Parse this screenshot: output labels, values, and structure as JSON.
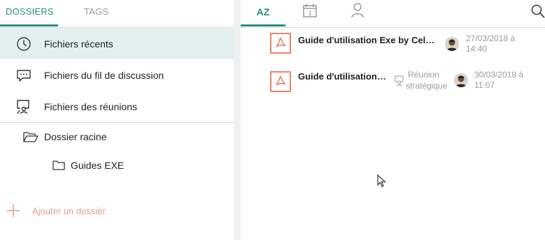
{
  "left_tabs": [
    {
      "label": "DOSSIERS",
      "active": true
    },
    {
      "label": "TAGS",
      "active": false
    }
  ],
  "nav": [
    {
      "label": "Fichiers récents",
      "icon": "clock-icon",
      "selected": true
    },
    {
      "label": "Fichiers du fil de discussion",
      "icon": "chat-bubble-icon",
      "selected": false
    },
    {
      "label": "Fichiers des réunions",
      "icon": "presentation-icon",
      "selected": false
    }
  ],
  "folders": [
    {
      "label": "Dossier racine",
      "icon": "folder-open-icon"
    },
    {
      "label": "Guides EXE",
      "icon": "folder-icon"
    }
  ],
  "add_folder_label": "Ajouter un dossier",
  "right_tabs": [
    {
      "label": "AZ",
      "active": true
    },
    {
      "label": "",
      "icon": "calendar-icon",
      "active": false
    },
    {
      "label": "",
      "icon": "person-icon",
      "active": false
    }
  ],
  "calendar_day": "1",
  "files": [
    {
      "name": "Guide d'utilisation Exe by Cell…",
      "icon": "pdf-icon",
      "date": "27/03/2018 à",
      "time": "14:40",
      "meeting": ""
    },
    {
      "name": "Guide d'utilisation…",
      "icon": "pdf-icon",
      "date": "30/03/2018 à",
      "time": "11:07",
      "meeting_line1": "Réunion",
      "meeting_line2": "stratégique"
    }
  ],
  "colors": {
    "accent": "#2b8a85",
    "selected_bg": "#e3f0ef",
    "pdf_red": "#e5836f",
    "add_folder": "#e8998c",
    "muted": "#9a9a9a"
  }
}
